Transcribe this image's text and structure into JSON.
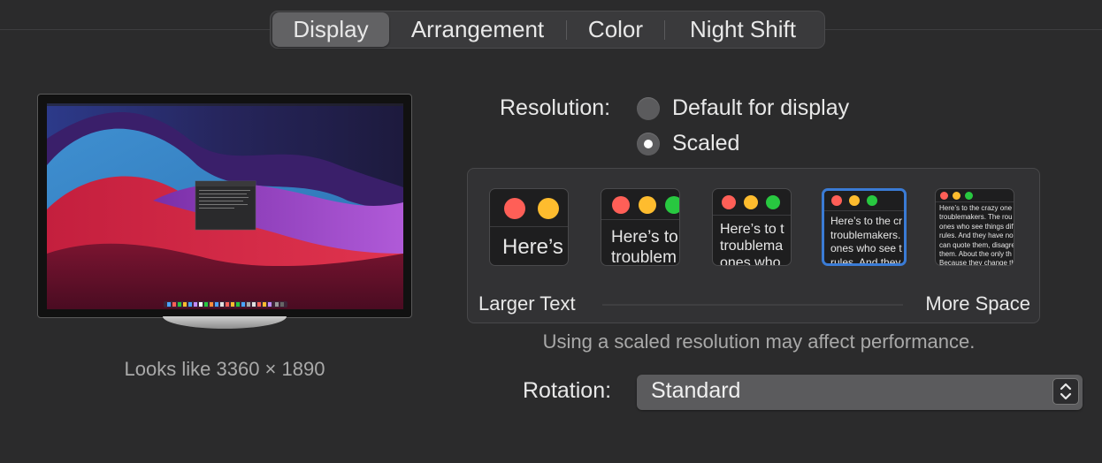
{
  "tabs": [
    {
      "label": "Display",
      "active": true
    },
    {
      "label": "Arrangement",
      "active": false
    },
    {
      "label": "Color",
      "active": false
    },
    {
      "label": "Night Shift",
      "active": false
    }
  ],
  "display_preview": {
    "looks_like": "Looks like 3360 × 1890"
  },
  "resolution": {
    "label": "Resolution:",
    "options": [
      {
        "label": "Default for display",
        "selected": false
      },
      {
        "label": "Scaled",
        "selected": true
      }
    ]
  },
  "scaled_options": {
    "previews": [
      {
        "text": "Here’s"
      },
      {
        "text": "Here’s to\ntroublem"
      },
      {
        "text": "Here’s to t\ntroublema\nones who"
      },
      {
        "text": "Here’s to the cr\ntroublemakers.\nones who see t\nrules. And they",
        "selected": true
      },
      {
        "text": "Here’s to the crazy one\ntroublemakers. The rou\nones who see things dif\nrules. And they have no\ncan quote them, disagre\nthem. About the only th\nBecause they change th"
      }
    ],
    "left_label": "Larger Text",
    "right_label": "More Space"
  },
  "warning": "Using a scaled resolution may affect performance.",
  "rotation": {
    "label": "Rotation:",
    "value": "Standard"
  },
  "colors": {
    "accent": "#3a7bd5",
    "traffic_red": "#ff5f57",
    "traffic_yellow": "#febc2e",
    "traffic_green": "#28c840"
  }
}
